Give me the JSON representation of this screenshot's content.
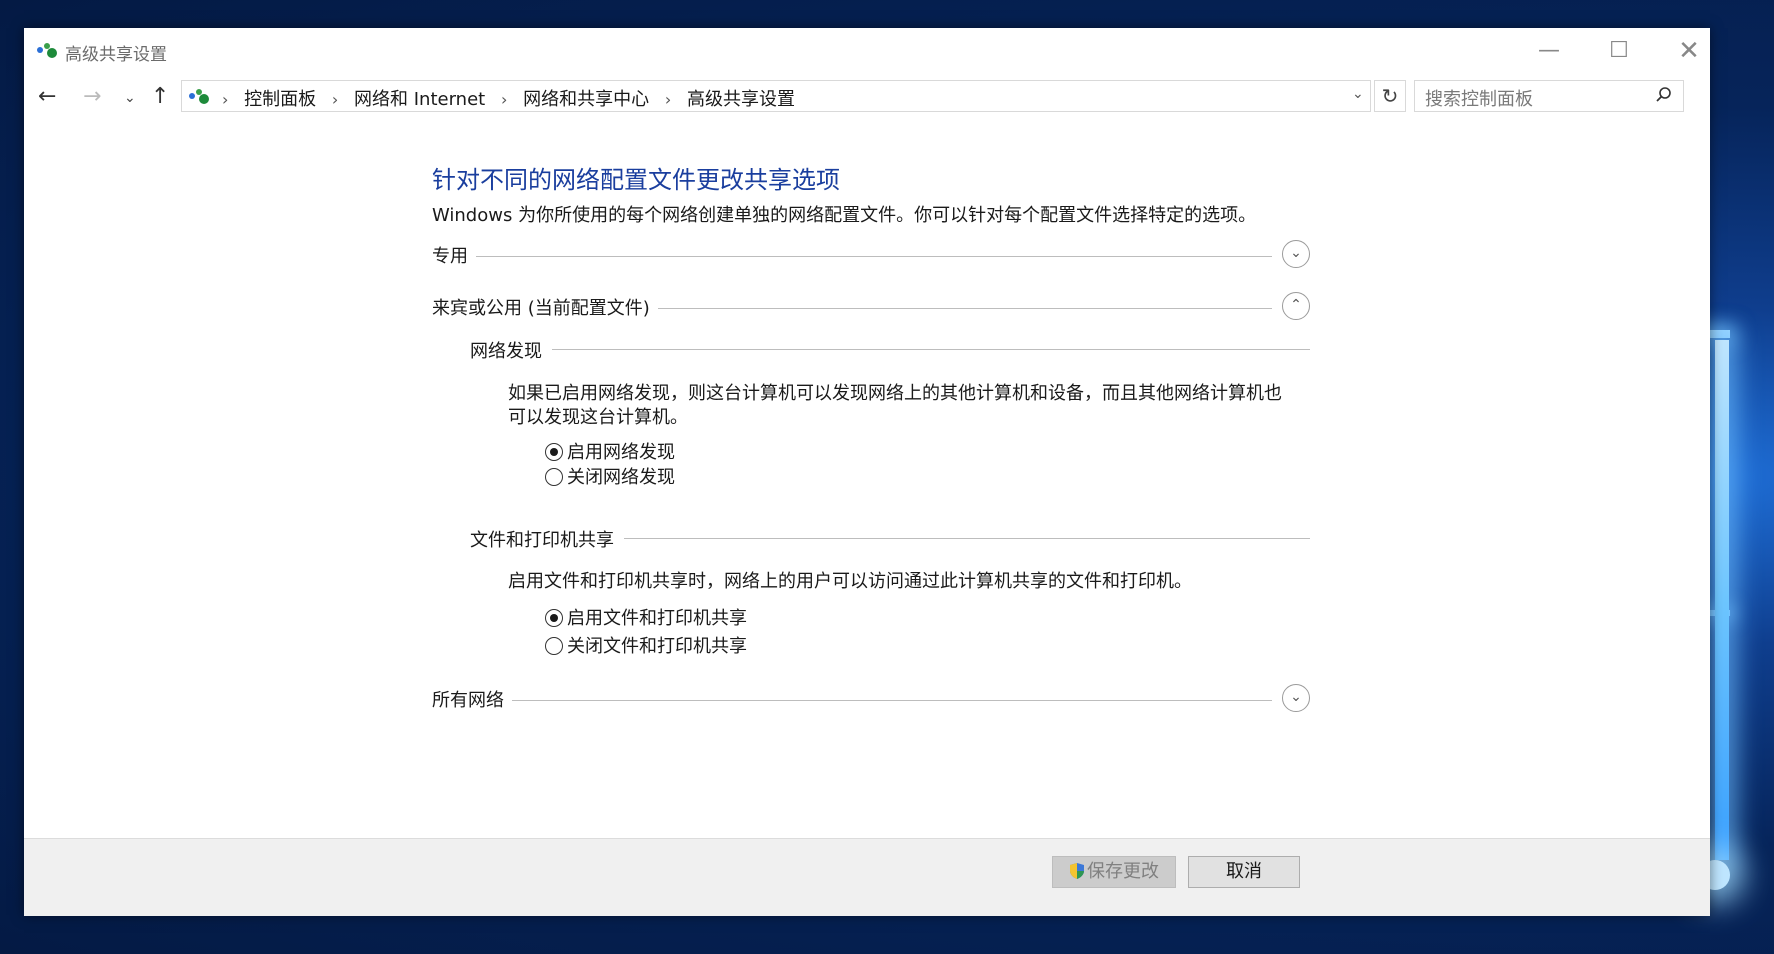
{
  "window": {
    "title": "高级共享设置",
    "controls": {
      "minimize": "—",
      "maximize": "☐",
      "close": "✕"
    }
  },
  "nav": {
    "back": "←",
    "forward": "→",
    "recent": "⌄",
    "up": "↑",
    "breadcrumbs": [
      "控制面板",
      "网络和 Internet",
      "网络和共享中心",
      "高级共享设置"
    ],
    "address_dropdown": "⌄",
    "refresh": "↻",
    "search_placeholder": "搜索控制面板"
  },
  "main": {
    "heading": "针对不同的网络配置文件更改共享选项",
    "intro": "Windows 为你所使用的每个网络创建单独的网络配置文件。你可以针对每个配置文件选择特定的选项。",
    "sections": [
      {
        "label": "专用",
        "expanded": false,
        "toggle": "⌄"
      },
      {
        "label": "来宾或公用 (当前配置文件)",
        "expanded": true,
        "toggle": "⌃"
      },
      {
        "label": "所有网络",
        "expanded": false,
        "toggle": "⌄"
      }
    ],
    "network_discovery": {
      "title": "网络发现",
      "description": "如果已启用网络发现，则这台计算机可以发现网络上的其他计算机和设备，而且其他网络计算机也可以发现这台计算机。",
      "options": [
        {
          "label": "启用网络发现",
          "selected": true
        },
        {
          "label": "关闭网络发现",
          "selected": false
        }
      ]
    },
    "file_printer_sharing": {
      "title": "文件和打印机共享",
      "description": "启用文件和打印机共享时，网络上的用户可以访问通过此计算机共享的文件和打印机。",
      "options": [
        {
          "label": "启用文件和打印机共享",
          "selected": true
        },
        {
          "label": "关闭文件和打印机共享",
          "selected": false
        }
      ]
    }
  },
  "footer": {
    "save_label": "保存更改",
    "cancel_label": "取消"
  },
  "colors": {
    "heading": "#1a3e9e",
    "desktop": "#06245a"
  }
}
